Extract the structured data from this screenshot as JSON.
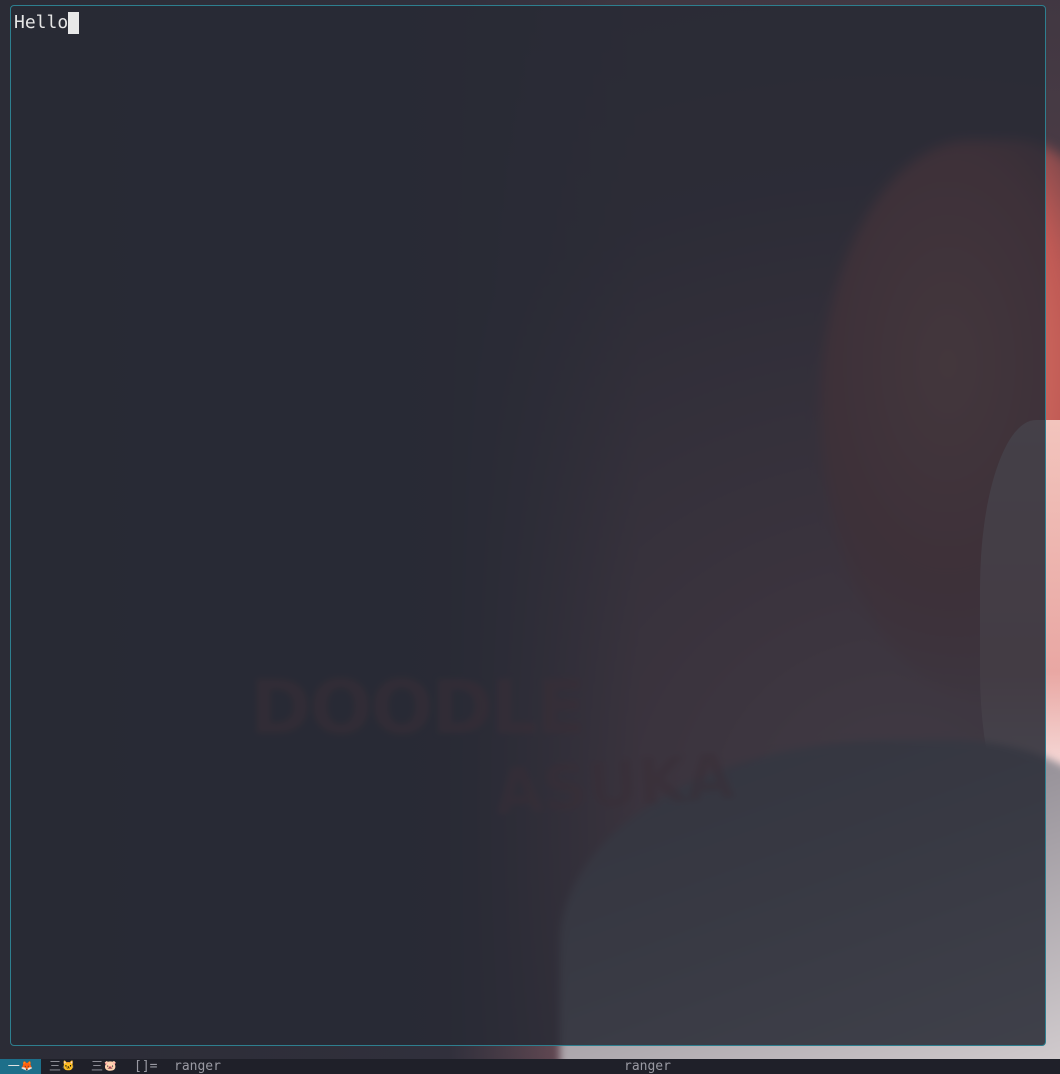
{
  "terminal": {
    "text": "Hello"
  },
  "statusbar": {
    "tags": [
      {
        "label": "一",
        "icon": "fox-icon"
      },
      {
        "label": "三",
        "icon": "cat-icon"
      },
      {
        "label": "三",
        "icon": "pig-icon"
      }
    ],
    "layout_symbol": "[]=",
    "focused_title": "ranger",
    "center_title": "ranger",
    "active_tag_color": "#1d6f8a"
  },
  "wallpaper": {
    "text_line_1": "DOODLE",
    "text_line_2": "ASUKA"
  }
}
